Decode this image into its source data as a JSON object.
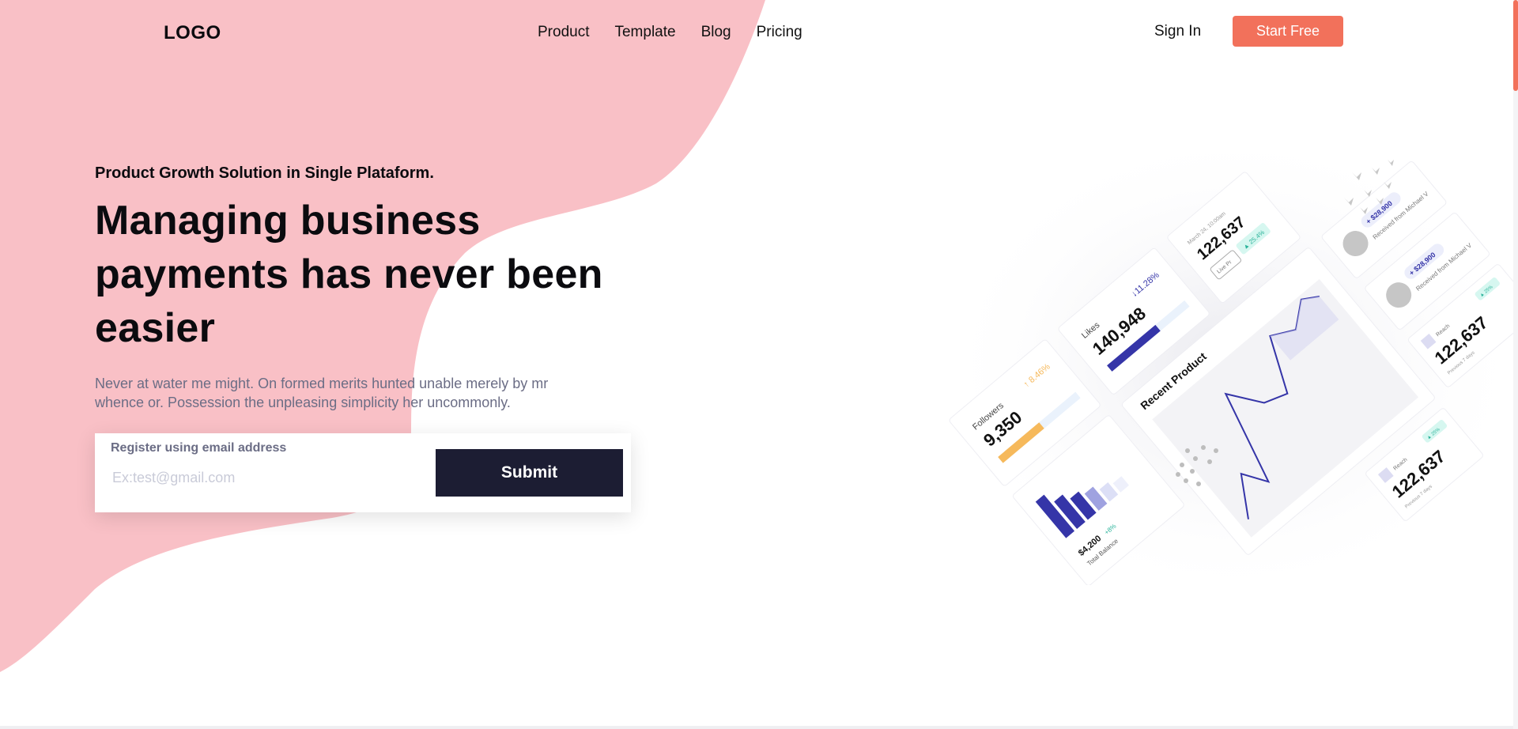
{
  "nav": {
    "logo": "LOGO",
    "items": [
      "Product",
      "Template",
      "Blog",
      "Pricing"
    ],
    "sign_in": "Sign In",
    "start_free": "Start Free"
  },
  "hero": {
    "eyebrow": "Product Growth Solution in Single Plataform.",
    "headline_lines": [
      "Managing business",
      "payments has never been",
      "easier"
    ],
    "description": "Never at water me might. On formed merits hunted unable merely by mr whence or. Possession the unpleasing simplicity her uncommonly."
  },
  "signup": {
    "label": "Register using email address",
    "placeholder": "Ex:test@gmail.com",
    "submit": "Submit"
  },
  "dashboard": {
    "followers_label": "Followers",
    "followers_value": "9,350",
    "followers_change": "↑ 8.46%",
    "likes_label": "Likes",
    "likes_value": "140,948",
    "likes_change": "↓11.28%",
    "top_value": "122,637",
    "top_date": "March 24, 10:00am",
    "top_badge": "▲ 25.4%",
    "live_label": "Live Pr",
    "recent_title": "Recent Product",
    "received_amount": "+ $28,900",
    "received_text": "Received from Michael V",
    "received_amount_2": "+ $28,900",
    "received_text_2": "Received from Michael V",
    "balance_value": "$4,200",
    "balance_label": "Total Balance",
    "balance_badge": "+8%",
    "reach_label": "Reach",
    "reach_value": "122,637",
    "reach_badge": "▲ 25%",
    "reach_sub": "Previous 7 days",
    "reach_label_2": "Reach",
    "reach_value_2": "122,637",
    "reach_badge_2": "▲ 25%",
    "reach_sub_2": "Previous 7 days"
  },
  "colors": {
    "accent": "#f2715b",
    "blob": "#f9c0c6",
    "dark": "#1c1d33",
    "indigo": "#3535a8",
    "amber": "#f6b95b",
    "muted_text": "#6b6d85"
  },
  "icons": {
    "birds": "birds-decoration-icon",
    "dots": "dots-decoration-icon"
  }
}
